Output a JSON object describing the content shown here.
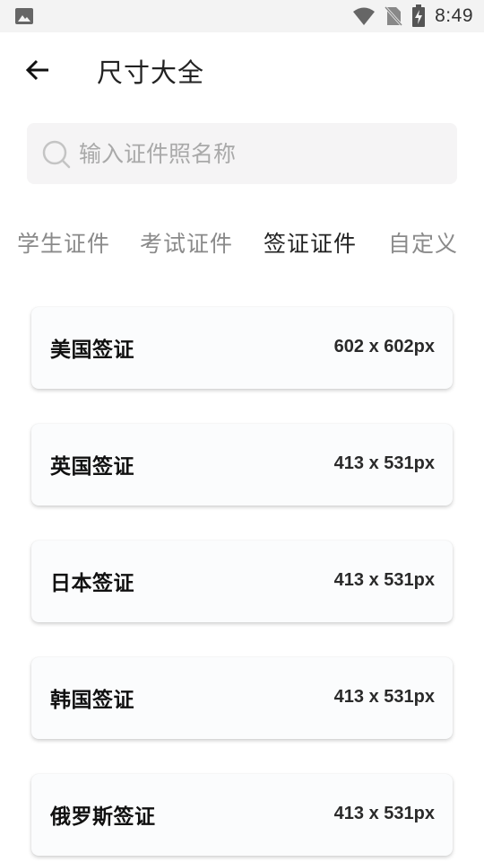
{
  "status_bar": {
    "time": "8:49",
    "icons": [
      "image-icon",
      "wifi-icon",
      "no-sim-icon",
      "battery-charging-icon"
    ]
  },
  "header": {
    "back_icon": "arrow-left-icon",
    "title": "尺寸大全"
  },
  "search": {
    "icon": "search-icon",
    "placeholder": "输入证件照名称",
    "value": ""
  },
  "tabs": [
    {
      "label": "学生证件",
      "active": false
    },
    {
      "label": "考试证件",
      "active": false
    },
    {
      "label": "签证证件",
      "active": true
    },
    {
      "label": "自定义",
      "active": false
    }
  ],
  "items": [
    {
      "name": "美国签证",
      "size": "602 x 602px"
    },
    {
      "name": "英国签证",
      "size": "413 x 531px"
    },
    {
      "name": "日本签证",
      "size": "413 x 531px"
    },
    {
      "name": "韩国签证",
      "size": "413 x 531px"
    },
    {
      "name": "俄罗斯签证",
      "size": "413 x 531px"
    }
  ],
  "colors": {
    "status_bar_bg": "#f3f3f3",
    "search_bg": "#f5f4f5",
    "tab_inactive": "#8a8a8a",
    "tab_active": "#222222",
    "card_bg": "#fbfcfd"
  }
}
